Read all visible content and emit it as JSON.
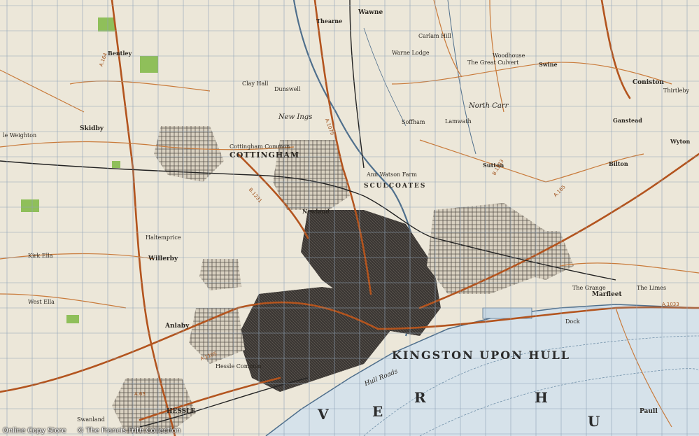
{
  "places": {
    "main_city": "KINGSTON UPON HULL",
    "cottingham": "COTTINGHAM",
    "sculcoates": "SCULCOATES",
    "coniston": "Coniston",
    "ganstead": "Ganstead",
    "swine": "Swine",
    "wawne": "Wawne",
    "thearne": "Thearne",
    "bilton": "Bilton",
    "wyton": "Wyton",
    "marfleet": "Marfleet",
    "paull": "Paull",
    "hessle": "HESSLE",
    "anlaby": "Anlaby",
    "willerby": "Willerby",
    "kirk_ella": "Kirk Ella",
    "west_ella": "West Ella",
    "skidby": "Skidby",
    "little_weighton": "le Weighton",
    "bentley": "Bentley",
    "new_ings": "New Ings",
    "sutton": "Sutton",
    "north_carr": "North Carr",
    "soffham": "Soffham",
    "lamwath": "Lamwath",
    "haltemprice": "Haltemprice",
    "newland": "Newland",
    "ann_watson": "Ann Watson Farm",
    "cottingham_common": "Cottingham Common",
    "clay_hall": "Clay Hall",
    "dunswell": "Dunswell",
    "the_great_culvert": "The Great Culvert",
    "warne_lodge": "Warne Lodge",
    "carlam_hill": "Carlam Hill",
    "woodhouse": "Woodhouse",
    "thirtleby": "Thirtleby",
    "humber_dock": "Dock",
    "the_limes": "The Limes",
    "the_grange": "The Grange",
    "hull_roads": "Hull Roads",
    "hessle_common": "Hessle Common",
    "swanland_dale": "Swanland"
  },
  "river": {
    "letters": [
      "V",
      "E",
      "R",
      "H",
      "U"
    ]
  },
  "roads": {
    "a164": "A.164",
    "a1079": "A.1079",
    "a165": "A.165",
    "a1033": "A.1033",
    "b1231": "B.1231",
    "a63": "A.63",
    "a1105": "A.1105",
    "b1233": "B.1233"
  },
  "footer": {
    "left": "Online Copy Store",
    "right": "© The Francis Frith Collection"
  },
  "colors": {
    "paper": "#ece7d9",
    "grid": "#8fa3b8",
    "road_major": "#b3541e",
    "road_minor": "#c97a3a",
    "urban": "#2c2a28",
    "water": "#c9d8e2",
    "water_line": "#4f6f8c",
    "woodland": "#8fbf5a",
    "railway": "#222222"
  }
}
